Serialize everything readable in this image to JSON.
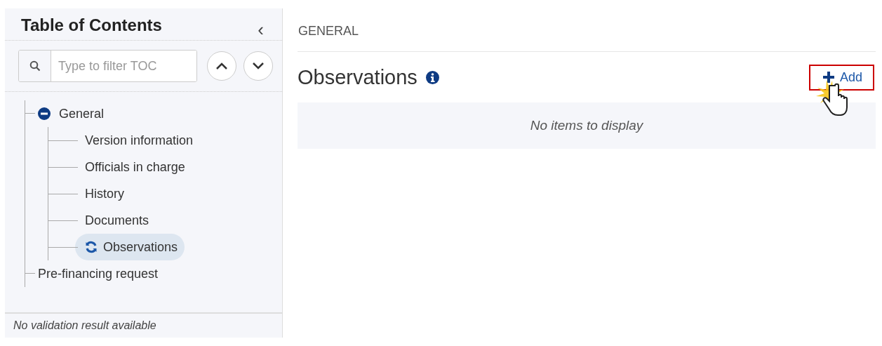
{
  "toc": {
    "title": "Table of Contents",
    "collapse_glyph": "‹",
    "filter": {
      "placeholder": "Type to filter TOC"
    },
    "items": [
      {
        "label": "General",
        "expanded": true,
        "selected": false,
        "children": [
          {
            "label": "Version information",
            "selected": false
          },
          {
            "label": "Officials in charge",
            "selected": false
          },
          {
            "label": "History",
            "selected": false
          },
          {
            "label": "Documents",
            "selected": false
          },
          {
            "label": "Observations",
            "selected": true
          }
        ]
      },
      {
        "label": "Pre-financing request",
        "selected": false
      }
    ],
    "footer": "No validation result available"
  },
  "main": {
    "breadcrumb": "GENERAL",
    "title": "Observations",
    "add_button": {
      "label": "Add",
      "highlighted": true
    },
    "empty_message": "No items to display"
  }
}
